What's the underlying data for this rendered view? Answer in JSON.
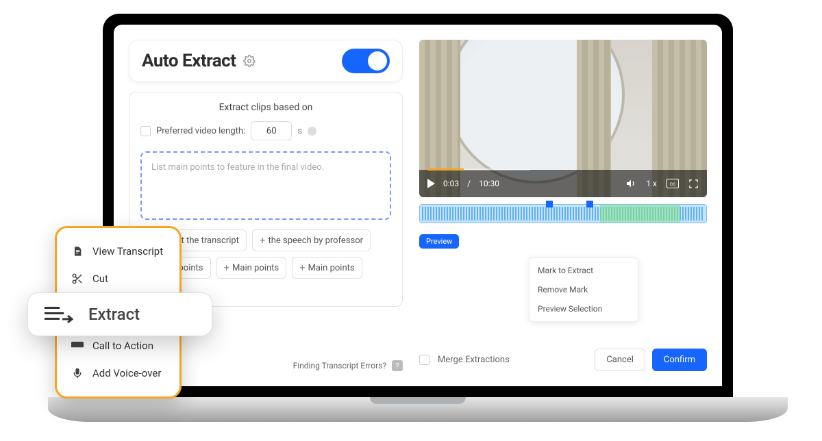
{
  "header": {
    "title": "Auto Extract",
    "toggle_on": true
  },
  "extract_panel": {
    "heading": "Extract clips based on",
    "preferred_length_label": "Preferred video length:",
    "preferred_length_value": "60",
    "preferred_length_unit": "s",
    "prompt_placeholder": "List main points to feature in the final video.",
    "suggestions": [
      "Extract the transcript",
      "the speech by professor",
      "Main points",
      "Main points",
      "Main points"
    ],
    "footer_hint": "Finding Transcript Errors?"
  },
  "sidebar_tools": {
    "items": [
      {
        "icon": "document-icon",
        "label": "View Transcript"
      },
      {
        "icon": "scissors-icon",
        "label": "Cut"
      },
      {
        "icon": "extract-icon",
        "label": "Extract"
      },
      {
        "icon": "cta-icon",
        "label": "Call to Action"
      },
      {
        "icon": "mic-icon",
        "label": "Add Voice-over"
      }
    ]
  },
  "extract_highlight_label": "Extract",
  "video": {
    "current_time": "0:03",
    "total_time": "10:30",
    "speed": "1 x",
    "cc_label": "cc"
  },
  "preview_label": "Preview",
  "context_menu": {
    "items": [
      "Mark to Extract",
      "Remove Mark",
      "Preview Selection"
    ]
  },
  "merge_label": "Merge Extractions",
  "buttons": {
    "cancel": "Cancel",
    "confirm": "Confirm"
  }
}
